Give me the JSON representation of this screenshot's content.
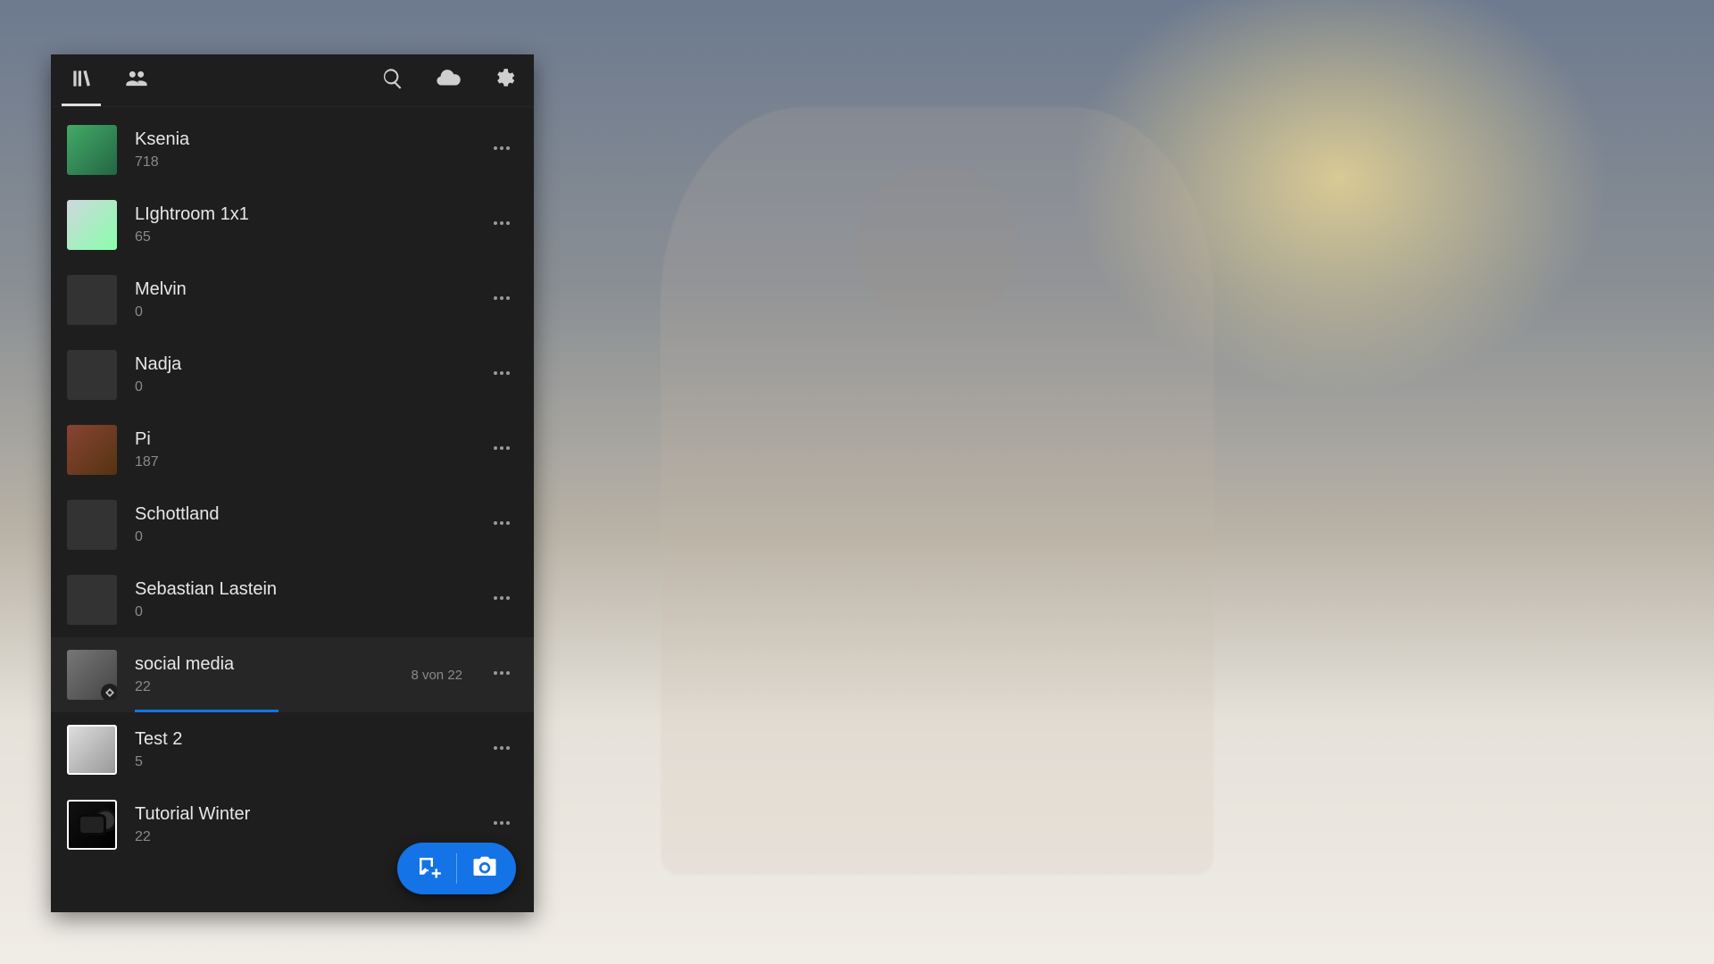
{
  "albums": [
    {
      "name": "Ksenia",
      "count": "718",
      "thumb": "g1",
      "hasThumb": true,
      "framed": false,
      "active": false
    },
    {
      "name": "LIghtroom 1x1",
      "count": "65",
      "thumb": "g2",
      "hasThumb": true,
      "framed": false,
      "active": false
    },
    {
      "name": "Melvin",
      "count": "0",
      "thumb": "",
      "hasThumb": false,
      "framed": false,
      "active": false
    },
    {
      "name": "Nadja",
      "count": "0",
      "thumb": "",
      "hasThumb": false,
      "framed": false,
      "active": false
    },
    {
      "name": "Pi",
      "count": "187",
      "thumb": "g3",
      "hasThumb": true,
      "framed": false,
      "active": false
    },
    {
      "name": "Schottland",
      "count": "0",
      "thumb": "",
      "hasThumb": false,
      "framed": false,
      "active": false
    },
    {
      "name": "Sebastian Lastein",
      "count": "0",
      "thumb": "",
      "hasThumb": false,
      "framed": false,
      "active": false
    },
    {
      "name": "social media",
      "count": "22",
      "thumb": "g4",
      "hasThumb": true,
      "framed": false,
      "active": true,
      "status": "8 von 22",
      "progress_pct": 36,
      "syncBadge": true
    },
    {
      "name": "Test 2",
      "count": "5",
      "thumb": "g5",
      "hasThumb": true,
      "framed": true,
      "active": false
    },
    {
      "name": "Tutorial Winter",
      "count": "22",
      "thumb": "g6",
      "hasThumb": true,
      "framed": true,
      "active": false
    }
  ]
}
